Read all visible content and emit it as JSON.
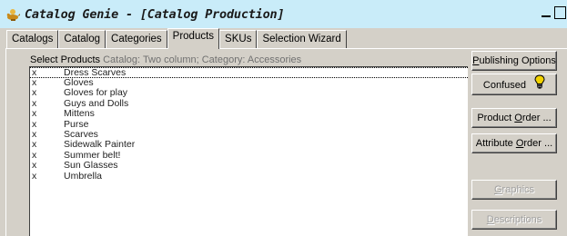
{
  "window": {
    "title": "Catalog Genie - [Catalog Production]",
    "controls": [
      "_",
      "□"
    ]
  },
  "tabs": [
    {
      "label": "Catalogs",
      "active": false
    },
    {
      "label": "Catalog",
      "active": false
    },
    {
      "label": "Categories",
      "active": false
    },
    {
      "label": "Products",
      "active": true
    },
    {
      "label": "SKUs",
      "active": false
    },
    {
      "label": "Selection Wizard",
      "active": false
    }
  ],
  "select": {
    "label": "Select Products",
    "context": "Catalog: Two column; Category: Accessories"
  },
  "products": [
    {
      "mark": "x",
      "name": "Dress Scarves"
    },
    {
      "mark": "x",
      "name": "Gloves"
    },
    {
      "mark": "x",
      "name": "Gloves for play"
    },
    {
      "mark": "x",
      "name": "Guys and Dolls"
    },
    {
      "mark": "x",
      "name": "Mittens"
    },
    {
      "mark": "x",
      "name": "Purse"
    },
    {
      "mark": "x",
      "name": "Scarves"
    },
    {
      "mark": "x",
      "name": "Sidewalk Painter"
    },
    {
      "mark": "x",
      "name": "Summer belt!"
    },
    {
      "mark": "x",
      "name": "Sun Glasses"
    },
    {
      "mark": "x",
      "name": "Umbrella"
    }
  ],
  "buttons": {
    "publishing_options": {
      "pre": "",
      "ul": "P",
      "post": "ublishing Options"
    },
    "confused": {
      "label": "Confused",
      "icon": "lightbulb-icon"
    },
    "product_order": {
      "pre": "Product ",
      "ul": "O",
      "post": "rder ..."
    },
    "attribute_order": {
      "pre": "Attribute ",
      "ul": "O",
      "post": "rder ..."
    },
    "graphics": {
      "pre": "",
      "ul": "G",
      "post": "raphics"
    },
    "descriptions": {
      "pre": "",
      "ul": "D",
      "post": "escriptions"
    }
  },
  "colors": {
    "titlebar": "#c9ecf9",
    "face": "#d4d0c8",
    "lightbulb": "#f2d200"
  }
}
